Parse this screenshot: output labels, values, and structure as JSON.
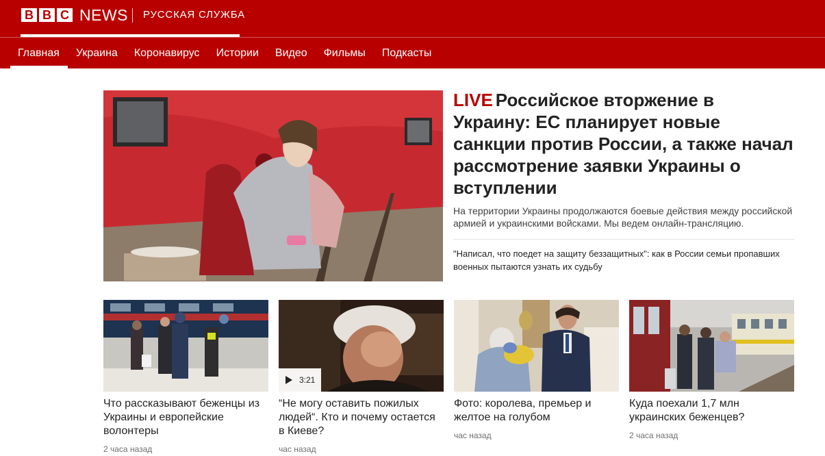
{
  "brand": {
    "logo_letters": [
      "B",
      "B",
      "C"
    ],
    "news_word": "NEWS",
    "service_name": "РУССКАЯ СЛУЖБА",
    "accent_color": "#b80000"
  },
  "nav": {
    "items": [
      {
        "label": "Главная",
        "active": true
      },
      {
        "label": "Украина"
      },
      {
        "label": "Коронавирус"
      },
      {
        "label": "Истории"
      },
      {
        "label": "Видео"
      },
      {
        "label": "Фильмы"
      },
      {
        "label": "Подкасты"
      }
    ]
  },
  "hero": {
    "live_label": "LIVE",
    "headline": "Российское вторжение в Украину: ЕС планирует новые санкции против России, а также начал рассмотрение заявки Украины о вступлении",
    "summary": "На территории Украины продолжаются боевые действия между российской армией и украинскими войсками. Мы ведем онлайн-трансляцию.",
    "related": "\"Написал, что поедет на защиту беззащитных\": как в России семьи пропавших военных пытаются узнать их судьбу"
  },
  "cards": [
    {
      "title": "Что рассказывают беженцы из Украины и европейские волонтеры",
      "time": "2 часа назад"
    },
    {
      "title": "“Не могу оставить пожилых людей“. Кто и почему остается в Киеве?",
      "time": "час назад",
      "video_duration": "3:21"
    },
    {
      "title": "Фото: королева, премьер и желтое на голубом",
      "time": "час назад"
    },
    {
      "title": "Куда поехали 1,7 млн украинских беженцев?",
      "time": "2 часа назад"
    }
  ],
  "icons": {
    "play": "play-icon"
  }
}
